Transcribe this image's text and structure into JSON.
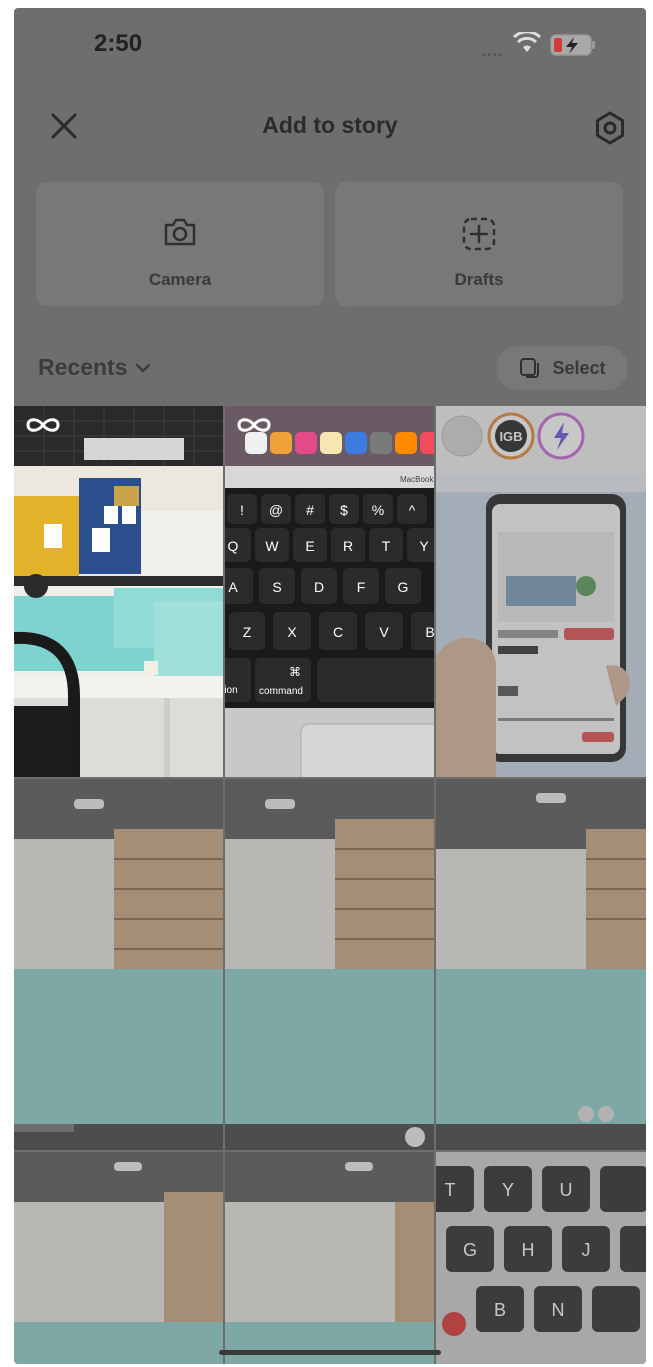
{
  "status": {
    "time": "2:50"
  },
  "header": {
    "title": "Add to story"
  },
  "tiles": [
    {
      "label": "Camera",
      "icon": "camera-icon"
    },
    {
      "label": "Drafts",
      "icon": "drafts-icon"
    }
  ],
  "recents": {
    "label": "Recents"
  },
  "select": {
    "label": "Select"
  },
  "photos": [
    {
      "type": "office-photo",
      "badge": "boomerang-icon"
    },
    {
      "type": "keyboard-photo",
      "badge": "boomerang-icon"
    },
    {
      "type": "app-screenshot",
      "story_labels": [
        "IGB"
      ]
    },
    {
      "type": "room-photo"
    },
    {
      "type": "room-photo"
    },
    {
      "type": "room-photo"
    },
    {
      "type": "room-photo"
    },
    {
      "type": "room-photo"
    },
    {
      "type": "keyboard-closeup"
    }
  ],
  "keyboard_keys": {
    "row1": [
      "!",
      "@",
      "#",
      "$",
      "%",
      "^"
    ],
    "row2": [
      "Q",
      "W",
      "E",
      "R",
      "T",
      "Y"
    ],
    "row3": [
      "A",
      "S",
      "D",
      "F",
      "G"
    ],
    "row4": [
      "Z",
      "X",
      "C",
      "V",
      "B"
    ],
    "cmd": "command",
    "cmd_symbol": "⌘",
    "opt": "ion",
    "brand": "MacBook Air"
  },
  "closeup_keys": [
    "T",
    "Y",
    "U",
    "G",
    "H",
    "J",
    "B",
    "N"
  ]
}
